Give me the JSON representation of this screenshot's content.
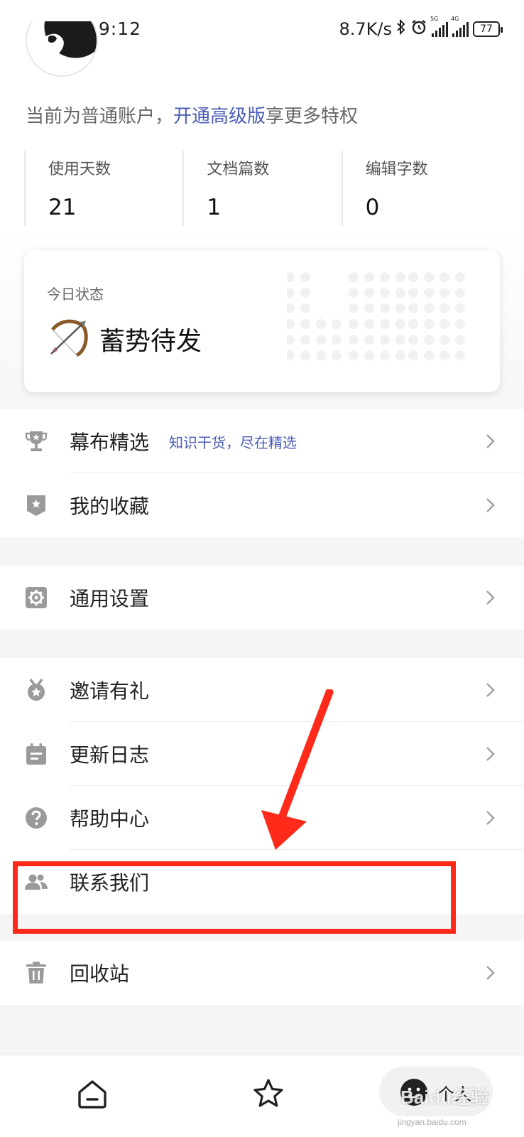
{
  "status_bar": {
    "time": "19:12",
    "net_speed": "8.7K/s",
    "sim1_tag": "5G",
    "sim2_tag": "4G",
    "battery": "77"
  },
  "profile": {
    "account_prefix": "当前为普通账户，",
    "upgrade_link": "开通高级版",
    "account_suffix": "享更多特权"
  },
  "stats": [
    {
      "label": "使用天数",
      "value": "21"
    },
    {
      "label": "文档篇数",
      "value": "1"
    },
    {
      "label": "编辑字数",
      "value": "0"
    }
  ],
  "today_card": {
    "label": "今日状态",
    "state": "蓄势待发",
    "state_icon": "bow-and-arrow-icon"
  },
  "menu": {
    "group1": [
      {
        "label": "幕布精选",
        "sub": "知识干货，尽在精选",
        "icon": "trophy-icon"
      },
      {
        "label": "我的收藏",
        "icon": "bookmark-star-icon"
      }
    ],
    "group2": [
      {
        "label": "通用设置",
        "icon": "gear-icon"
      }
    ],
    "group3": [
      {
        "label": "邀请有礼",
        "icon": "medal-icon"
      },
      {
        "label": "更新日志",
        "icon": "calendar-icon"
      },
      {
        "label": "帮助中心",
        "icon": "help-icon"
      },
      {
        "label": "联系我们",
        "icon": "people-icon"
      }
    ],
    "group4": [
      {
        "label": "回收站",
        "icon": "trash-icon"
      }
    ]
  },
  "bottom_nav": {
    "me_label": "个人"
  },
  "watermark": {
    "text": "Baidu经验",
    "sub": "jingyan.baidu.com"
  },
  "colors": {
    "link": "#4a5db6",
    "highlight": "#ff2a1a",
    "icon_gray": "#9a9a9a"
  }
}
